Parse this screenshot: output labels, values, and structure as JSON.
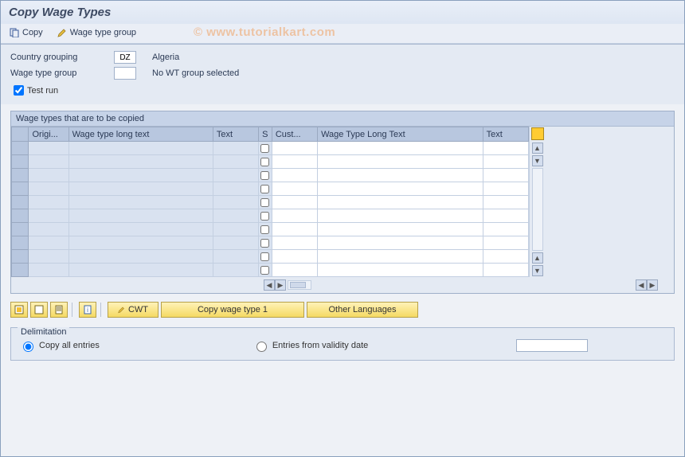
{
  "title": "Copy Wage Types",
  "toolbar": {
    "copy_label": "Copy",
    "wtg_label": "Wage type group"
  },
  "watermark": "© www.tutorialkart.com",
  "form": {
    "country_grouping_label": "Country grouping",
    "country_grouping_value": "DZ",
    "country_grouping_text": "Algeria",
    "wage_type_group_label": "Wage type group",
    "wage_type_group_value": "",
    "wage_type_group_text": "No WT group selected",
    "test_run_label": "Test run",
    "test_run_checked": true
  },
  "grid": {
    "title": "Wage types that are to be copied",
    "columns": {
      "origi": "Origi...",
      "wtlt": "Wage type long text",
      "text": "Text",
      "s": "S",
      "cust": "Cust...",
      "wtlt2": "Wage Type Long Text",
      "text2": "Text"
    },
    "row_count": 10
  },
  "buttons": {
    "cwt": "CWT",
    "copy_wt1": "Copy wage type 1",
    "other_lang": "Other Languages"
  },
  "delimitation": {
    "legend": "Delimitation",
    "copy_all": "Copy all entries",
    "entries_from": "Entries from validity date",
    "date_value": ""
  }
}
